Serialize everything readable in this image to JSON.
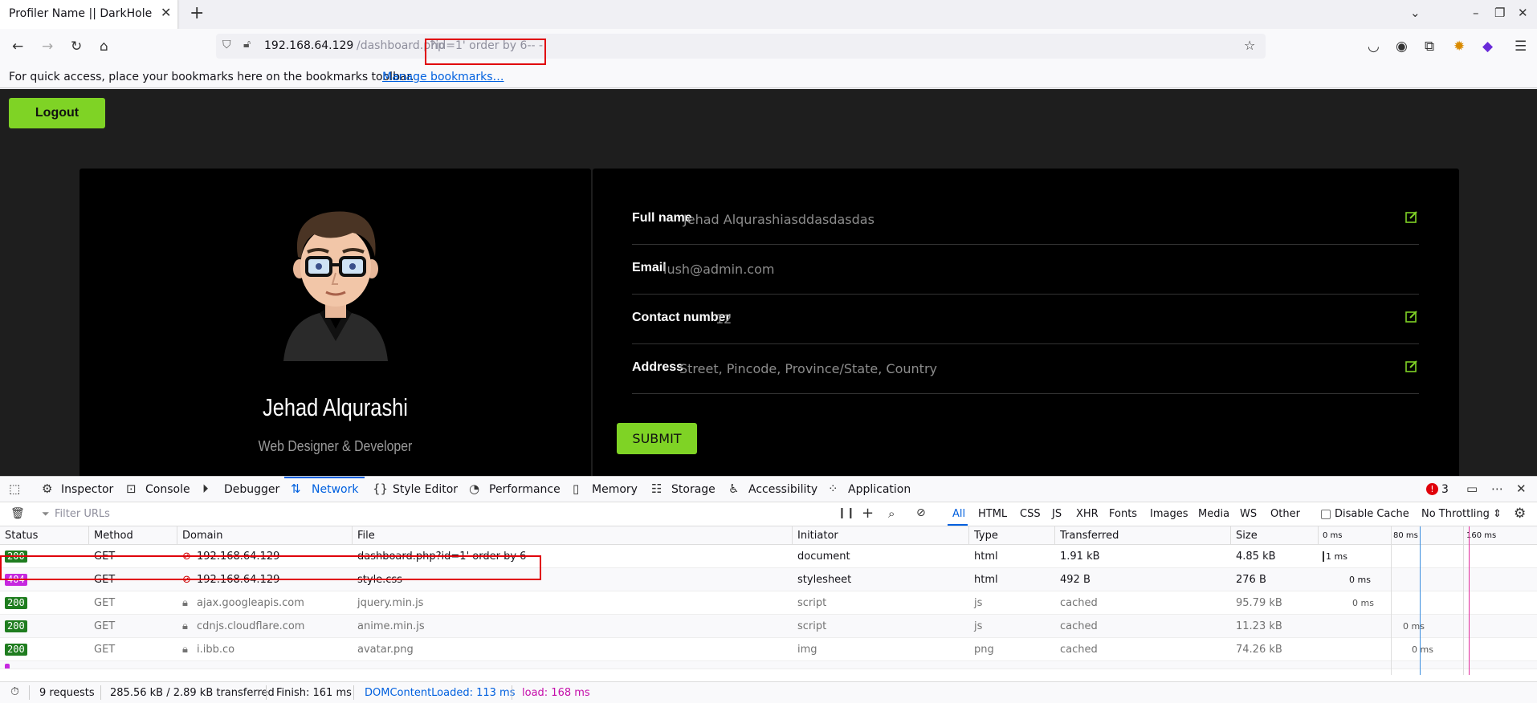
{
  "browser": {
    "tab_title": "Profiler Name || DarkHole",
    "url_host": "192.168.64.129",
    "url_path": "/dashboard.php",
    "url_query": "?id=1' order by 6-- -",
    "bookmarks_text": "For quick access, place your bookmarks here on the bookmarks toolbar.",
    "bookmarks_link": "Manage bookmarks…"
  },
  "page": {
    "logout_label": "Logout",
    "profile_name": "Jehad Alqurashi",
    "profile_role": "Web Designer & Developer",
    "fields": [
      {
        "label": "Full name",
        "value": "Jehad Alqurashiasddasdasdas"
      },
      {
        "label": "Email",
        "value": "lush@admin.com"
      },
      {
        "label": "Contact number",
        "value": "12"
      },
      {
        "label": "Address",
        "value": "Street, Pincode, Province/State, Country"
      }
    ],
    "submit_label": "SUBMIT",
    "accent_color": "#7fd325"
  },
  "devtools": {
    "tabs": [
      "Inspector",
      "Console",
      "Debugger",
      "Network",
      "Style Editor",
      "Performance",
      "Memory",
      "Storage",
      "Accessibility",
      "Application"
    ],
    "error_count": "3",
    "filter_placeholder": "Filter URLs",
    "filter_types": [
      "All",
      "HTML",
      "CSS",
      "JS",
      "XHR",
      "Fonts",
      "Images",
      "Media",
      "WS",
      "Other"
    ],
    "disable_cache": "Disable Cache",
    "throttling": "No Throttling ⇕",
    "columns": [
      "Status",
      "Method",
      "Domain",
      "File",
      "Initiator",
      "Type",
      "Transferred",
      "Size"
    ],
    "timeline_ticks": [
      "0 ms",
      "80 ms",
      "160 ms"
    ],
    "rows": [
      {
        "status": "200",
        "method": "GET",
        "domain": "192.168.64.129",
        "file": "dashboard.php?id=1' order by 6-- -",
        "initiator": "document",
        "type": "html",
        "transferred": "1.91 kB",
        "size": "4.85 kB",
        "time": "1 ms"
      },
      {
        "status": "404",
        "method": "GET",
        "domain": "192.168.64.129",
        "file": "style.css",
        "initiator": "stylesheet",
        "type": "html",
        "transferred": "492 B",
        "size": "276 B",
        "time": "0 ms"
      },
      {
        "status": "200",
        "method": "GET",
        "domain": "ajax.googleapis.com",
        "file": "jquery.min.js",
        "initiator": "script",
        "type": "js",
        "transferred": "cached",
        "size": "95.79 kB",
        "time": "0 ms"
      },
      {
        "status": "200",
        "method": "GET",
        "domain": "cdnjs.cloudflare.com",
        "file": "anime.min.js",
        "initiator": "script",
        "type": "js",
        "transferred": "cached",
        "size": "11.23 kB",
        "time": "0 ms"
      },
      {
        "status": "200",
        "method": "GET",
        "domain": "i.ibb.co",
        "file": "avatar.png",
        "initiator": "img",
        "type": "png",
        "transferred": "cached",
        "size": "74.26 kB",
        "time": "0 ms"
      }
    ],
    "summary": {
      "requests": "9 requests",
      "transferred": "285.56 kB / 2.89 kB transferred",
      "finish": "Finish: 161 ms",
      "dom_loaded": "DOMContentLoaded: 113 ms",
      "load": "load: 168 ms"
    }
  }
}
